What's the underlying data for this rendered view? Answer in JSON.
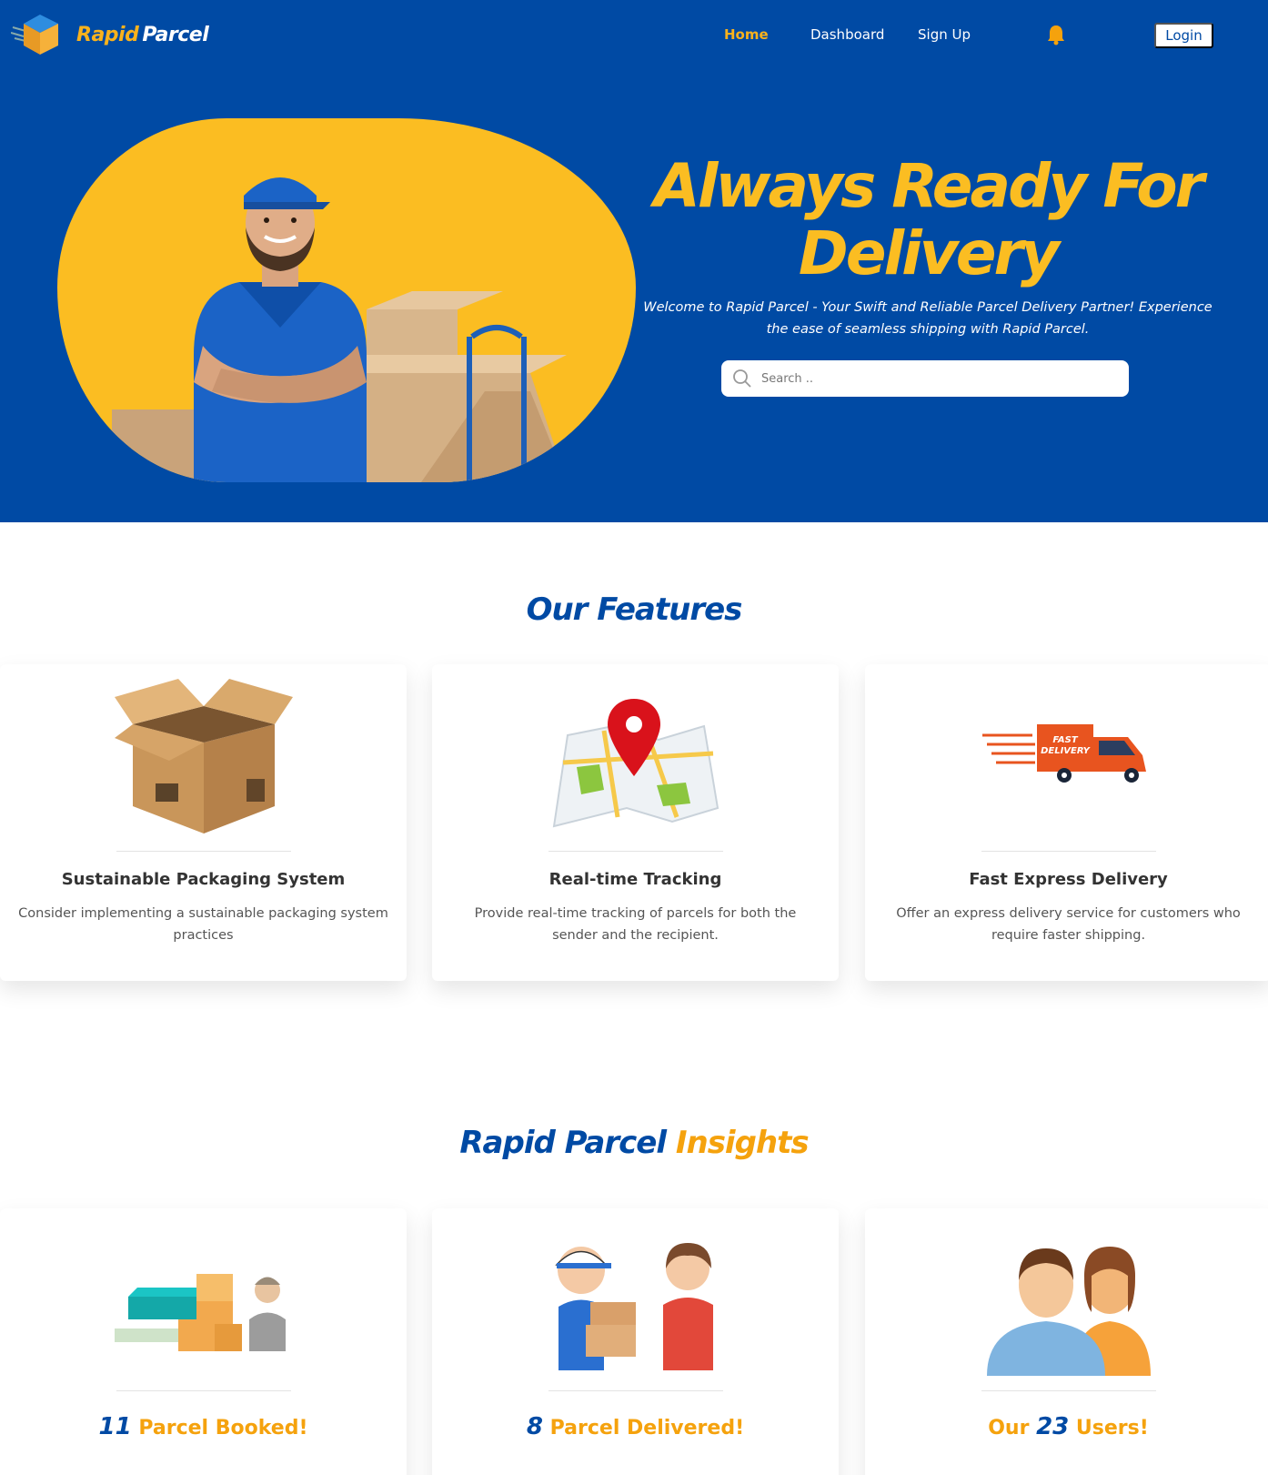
{
  "brand": {
    "word1": "Rapid",
    "word2": "Parcel"
  },
  "nav": {
    "home": "Home",
    "dashboard": "Dashboard",
    "signup": "Sign Up",
    "login": "Login"
  },
  "hero": {
    "title": "Always Ready For Delivery",
    "subtitle": "Welcome to Rapid Parcel - Your Swift and Reliable Parcel Delivery Partner! Experience the ease of seamless shipping with Rapid Parcel.",
    "search_placeholder": "Search .."
  },
  "features": {
    "title": "Our Features",
    "items": [
      {
        "title": "Sustainable Packaging System",
        "desc": "Consider implementing a sustainable packaging system practices"
      },
      {
        "title": "Real-time Tracking",
        "desc": "Provide real-time tracking of parcels for both the sender and the recipient."
      },
      {
        "title": "Fast Express Delivery",
        "desc": "Offer an express delivery service for customers who require faster shipping."
      }
    ]
  },
  "insights": {
    "title_part1": "Rapid Parcel",
    "title_part2": "Insights",
    "items": [
      {
        "prefix": "",
        "num": "11",
        "suffix": " Parcel Booked!"
      },
      {
        "prefix": "",
        "num": "8",
        "suffix": " Parcel Delivered!"
      },
      {
        "prefix": "Our ",
        "num": "23",
        "suffix": " Users!"
      }
    ]
  },
  "truck_text": {
    "line1": "FAST",
    "line2": "DELIVERY"
  },
  "colors": {
    "primary": "#004aa4",
    "accent": "#fbbd22",
    "orange": "#f5a20d"
  },
  "icons": [
    "cube-logo-icon",
    "bell-icon",
    "search-icon",
    "box-icon",
    "map-pin-icon",
    "truck-icon"
  ]
}
